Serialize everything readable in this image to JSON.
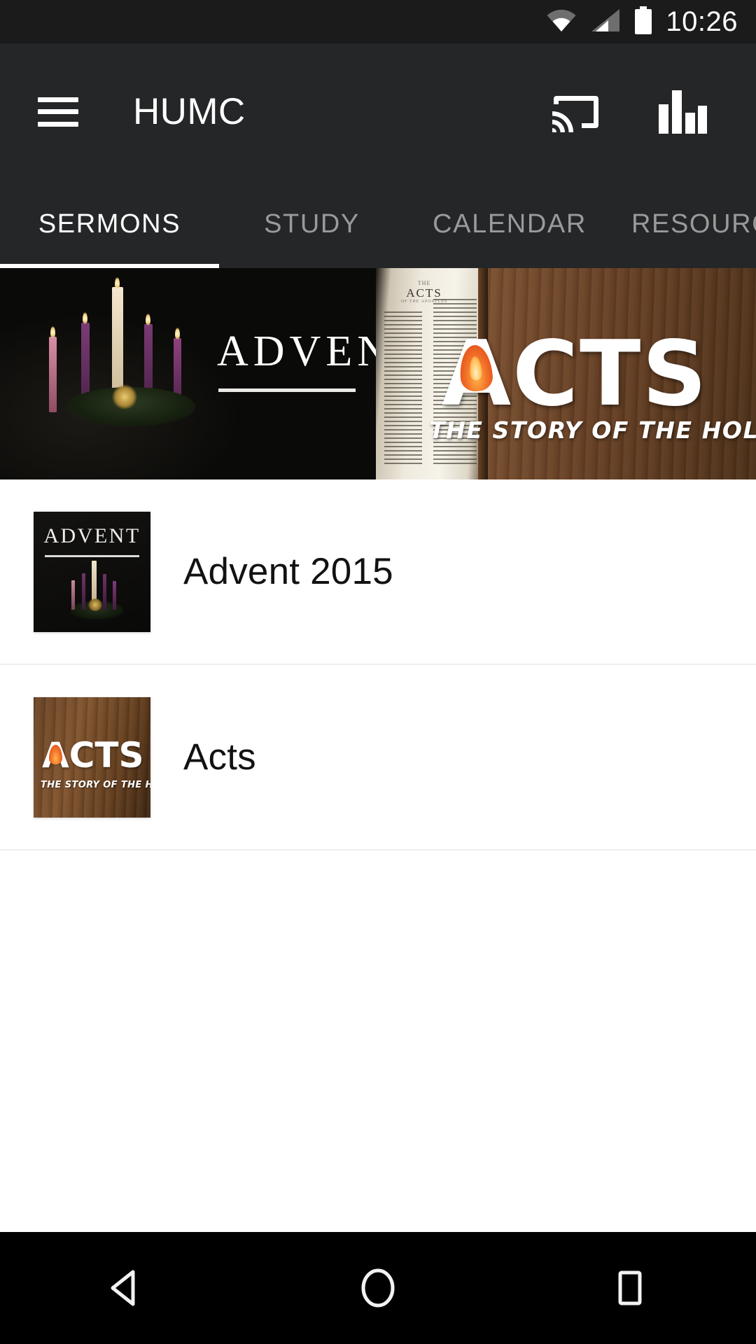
{
  "status_bar": {
    "time": "10:26",
    "icons": [
      "wifi-icon",
      "cellular-signal-icon",
      "battery-icon"
    ]
  },
  "toolbar": {
    "menu_icon": "hamburger-menu-icon",
    "title": "HUMC",
    "actions": [
      {
        "name": "cast-icon",
        "label": "Cast"
      },
      {
        "name": "equalizer-icon",
        "label": "Equalizer"
      }
    ]
  },
  "tabs": {
    "items": [
      {
        "label": "SERMONS",
        "active": true
      },
      {
        "label": "STUDY",
        "active": false
      },
      {
        "label": "CALENDAR",
        "active": false
      },
      {
        "label": "RESOURCES",
        "active": false
      }
    ],
    "active_index": 0
  },
  "hero": {
    "slides": [
      {
        "name": "advent-banner",
        "title": "ADVENT",
        "art": "advent-candles"
      },
      {
        "name": "acts-banner",
        "title": "ACTS",
        "subtitle": "THE STORY OF THE HOLY SPIRIT",
        "bible_heading_top": "THE",
        "bible_heading_main": "ACTS",
        "bible_heading_sub": "OF THE APOSTLES",
        "art": "open-bible-on-wood"
      }
    ]
  },
  "list": {
    "items": [
      {
        "label": "Advent 2015",
        "thumb_title": "ADVENT",
        "thumb": "advent-thumbnail"
      },
      {
        "label": "Acts",
        "thumb_title": "ACTS",
        "thumb_subtitle": "THE STORY OF THE HOLY SPIRIT",
        "thumb": "acts-thumbnail"
      }
    ]
  },
  "navbar": {
    "buttons": [
      {
        "name": "nav-back-button",
        "label": "Back"
      },
      {
        "name": "nav-home-button",
        "label": "Home"
      },
      {
        "name": "nav-recents-button",
        "label": "Recents"
      }
    ]
  },
  "colors": {
    "toolbar_bg": "#252628",
    "status_bg": "#1b1b1b",
    "accent_white": "#ffffff",
    "tab_inactive": "#9a9a9a",
    "list_bg": "#ffffff",
    "divider": "#eceef0",
    "navbar_bg": "#000000",
    "flame_orange": "#f2722a",
    "wood_brown": "#6d4526"
  }
}
